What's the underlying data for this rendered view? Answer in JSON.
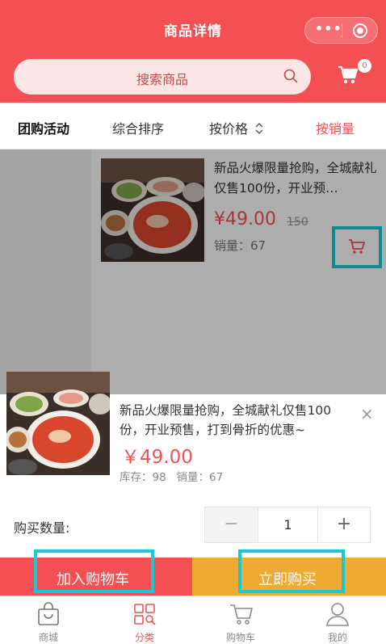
{
  "nav": {
    "title": "商品详情",
    "more_icon": "•••"
  },
  "search": {
    "placeholder": "搜索商品",
    "cart_badge": "0"
  },
  "tabs": [
    {
      "label": "团购活动"
    },
    {
      "label": "综合排序"
    },
    {
      "label": "按价格"
    },
    {
      "label": "按销量"
    }
  ],
  "product": {
    "title": "新品火爆限量抢购，全城献礼仅售100份，开业预…",
    "price": "¥49.00",
    "original_price": "150",
    "sales": "销量：67"
  },
  "popup": {
    "title": "新品火爆限量抢购，全城献礼仅售100份，开业预售，打到骨折的优惠~",
    "price": "￥49.00",
    "stock": "库存：98   销量：67",
    "close": "×",
    "quantity_label": "购买数量:",
    "quantity_value": "1",
    "minus": "−",
    "plus": "+",
    "add_to_cart": "加入购物车",
    "buy_now": "立即购买"
  },
  "tabbar": [
    {
      "label": "商城",
      "icon": "bag-icon"
    },
    {
      "label": "分类",
      "icon": "category-icon"
    },
    {
      "label": "购物车",
      "icon": "cart-icon"
    },
    {
      "label": "我的",
      "icon": "user-icon"
    }
  ],
  "colors": {
    "primary": "#f45054",
    "buy": "#eeaa33",
    "highlight": "#19c9d3"
  }
}
